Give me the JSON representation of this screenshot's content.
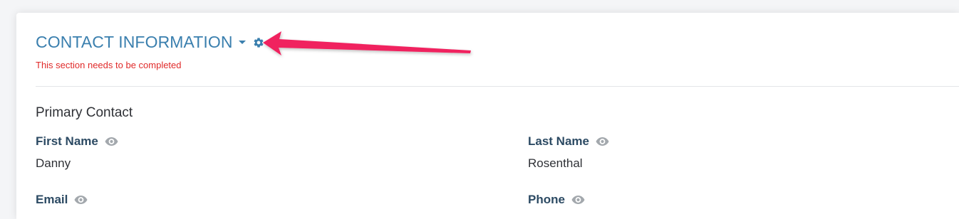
{
  "section": {
    "title": "CONTACT INFORMATION",
    "warning": "This section needs to be completed",
    "subsection_title": "Primary Contact",
    "accent_color": "#3a7fae",
    "warning_color": "#e02a2a"
  },
  "fields": {
    "first_name": {
      "label": "First Name",
      "value": "Danny"
    },
    "last_name": {
      "label": "Last Name",
      "value": "Rosenthal"
    },
    "email": {
      "label": "Email"
    },
    "phone": {
      "label": "Phone"
    }
  },
  "icons": {
    "caret": "chevron-down-icon",
    "settings": "gear-icon",
    "visibility": "eye-icon",
    "annotation": "arrow-annotation",
    "annotation_color": "#f0245e"
  }
}
